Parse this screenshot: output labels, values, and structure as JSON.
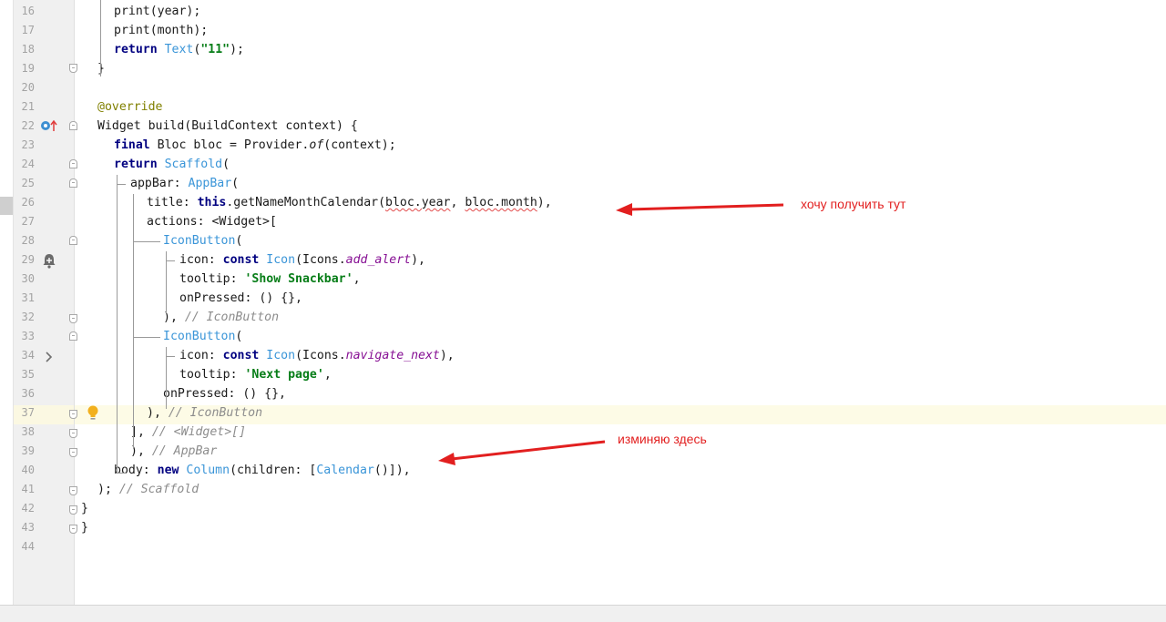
{
  "editor": {
    "lines": [
      {
        "n": "16",
        "parts": [
          [
            "print(year);",
            "t"
          ]
        ]
      },
      {
        "n": "17",
        "parts": [
          [
            "print(month);",
            "t"
          ]
        ]
      },
      {
        "n": "18",
        "parts": [
          [
            "return",
            "kw"
          ],
          [
            " ",
            "t"
          ],
          [
            "Text",
            "cls"
          ],
          [
            "(",
            "t"
          ],
          [
            "\"11\"",
            "str"
          ],
          [
            ");",
            "t"
          ]
        ]
      },
      {
        "n": "19",
        "parts": [
          [
            "}",
            "t"
          ]
        ]
      },
      {
        "n": "20",
        "parts": []
      },
      {
        "n": "21",
        "parts": [
          [
            "@override",
            "ann"
          ]
        ]
      },
      {
        "n": "22",
        "parts": [
          [
            "Widget build(BuildContext context) {",
            "t"
          ]
        ]
      },
      {
        "n": "23",
        "parts": [
          [
            "final",
            "kw"
          ],
          [
            " Bloc bloc = Provider.",
            "t"
          ],
          [
            "of",
            "italc"
          ],
          [
            "(context);",
            "t"
          ]
        ]
      },
      {
        "n": "24",
        "parts": [
          [
            "return",
            "kw"
          ],
          [
            " ",
            "t"
          ],
          [
            "Scaffold",
            "cls"
          ],
          [
            "(",
            "t"
          ]
        ]
      },
      {
        "n": "25",
        "parts": [
          [
            "appBar: ",
            "t"
          ],
          [
            "AppBar",
            "cls"
          ],
          [
            "(",
            "t"
          ]
        ]
      },
      {
        "n": "26",
        "parts": [
          [
            "title: ",
            "t"
          ],
          [
            "this",
            "kw"
          ],
          [
            ".getNameMonthCalendar(",
            "t"
          ],
          [
            "bloc.year",
            "squig"
          ],
          [
            ", ",
            "t"
          ],
          [
            "bloc.month",
            "squig"
          ],
          [
            "),",
            "t"
          ]
        ]
      },
      {
        "n": "27",
        "parts": [
          [
            "actions: <Widget>[",
            "t"
          ]
        ]
      },
      {
        "n": "28",
        "parts": [
          [
            "IconButton",
            "cls"
          ],
          [
            "(",
            "t"
          ]
        ]
      },
      {
        "n": "29",
        "parts": [
          [
            "icon: ",
            "t"
          ],
          [
            "const",
            "kw"
          ],
          [
            " ",
            "t"
          ],
          [
            "Icon",
            "cls"
          ],
          [
            "(Icons.",
            "t"
          ],
          [
            "add_alert",
            "ital"
          ],
          [
            "),",
            "t"
          ]
        ]
      },
      {
        "n": "30",
        "parts": [
          [
            "tooltip: ",
            "t"
          ],
          [
            "'Show Snackbar'",
            "str"
          ],
          [
            ",",
            "t"
          ]
        ]
      },
      {
        "n": "31",
        "parts": [
          [
            "onPressed: () {},",
            "t"
          ]
        ]
      },
      {
        "n": "32",
        "parts": [
          [
            "), ",
            "t"
          ],
          [
            "// IconButton",
            "cmt"
          ]
        ]
      },
      {
        "n": "33",
        "parts": [
          [
            "IconButton",
            "cls"
          ],
          [
            "(",
            "t"
          ]
        ]
      },
      {
        "n": "34",
        "parts": [
          [
            "icon: ",
            "t"
          ],
          [
            "const",
            "kw"
          ],
          [
            " ",
            "t"
          ],
          [
            "Icon",
            "cls"
          ],
          [
            "(Icons.",
            "t"
          ],
          [
            "navigate_next",
            "ital"
          ],
          [
            "),",
            "t"
          ]
        ]
      },
      {
        "n": "35",
        "parts": [
          [
            "tooltip: ",
            "t"
          ],
          [
            "'Next page'",
            "str"
          ],
          [
            ",",
            "t"
          ]
        ]
      },
      {
        "n": "36",
        "parts": [
          [
            "onPressed: () {},",
            "t"
          ]
        ]
      },
      {
        "n": "37",
        "parts": [
          [
            "), ",
            "t"
          ],
          [
            "// IconButton",
            "cmt"
          ]
        ]
      },
      {
        "n": "38",
        "parts": [
          [
            "], ",
            "t"
          ],
          [
            "// <Widget>[]",
            "cmt"
          ]
        ]
      },
      {
        "n": "39",
        "parts": [
          [
            "), ",
            "t"
          ],
          [
            "// AppBar",
            "cmt"
          ]
        ]
      },
      {
        "n": "40",
        "parts": [
          [
            "body: ",
            "t"
          ],
          [
            "new",
            "kw"
          ],
          [
            " ",
            "t"
          ],
          [
            "Column",
            "cls"
          ],
          [
            "(children: [",
            "t"
          ],
          [
            "Calendar",
            "cls"
          ],
          [
            "()]),",
            "t"
          ]
        ]
      },
      {
        "n": "41",
        "parts": [
          [
            "); ",
            "t"
          ],
          [
            "// Scaffold",
            "cmt"
          ]
        ]
      },
      {
        "n": "42",
        "parts": [
          [
            "}",
            "t"
          ]
        ]
      },
      {
        "n": "43",
        "parts": [
          [
            "}",
            "t"
          ]
        ]
      },
      {
        "n": "44",
        "parts": []
      }
    ]
  },
  "annotations": {
    "first": "хочу получить тут",
    "second": "изминяю здесь",
    "arrow_color": "#e21f1f"
  },
  "gutter_icons": {
    "line22": "override-method-icon",
    "line29": "bell-icon",
    "line34": "chevron-right-icon",
    "line37": "lightbulb-icon"
  },
  "colors": {
    "keyword": "#000080",
    "class": "#3a95d8",
    "string": "#067d17",
    "comment": "#8c8c8c"
  }
}
